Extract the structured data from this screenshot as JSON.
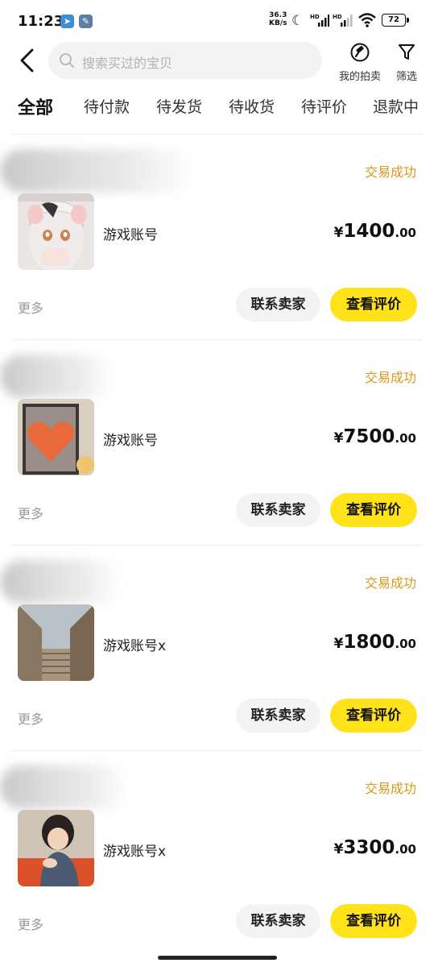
{
  "status_bar": {
    "time": "11:23",
    "net_speed_value": "36.3",
    "net_speed_unit": "KB/s",
    "battery": "72",
    "icons": [
      "telegram-icon",
      "tools-icon",
      "moon-icon",
      "signal-icon",
      "signal-icon",
      "wifi-icon",
      "battery-icon"
    ]
  },
  "header": {
    "search_placeholder": "搜索买过的宝贝",
    "auction_label": "我的拍卖",
    "filter_label": "筛选"
  },
  "tabs": [
    {
      "label": "全部",
      "active": true
    },
    {
      "label": "待付款"
    },
    {
      "label": "待发货"
    },
    {
      "label": "待收货"
    },
    {
      "label": "待评价"
    },
    {
      "label": "退款中"
    }
  ],
  "orders": [
    {
      "status": "交易成功",
      "title": "游戏账号",
      "currency": "¥",
      "price_int": "1400",
      "price_dec": ".00",
      "more": "更多",
      "contact": "联系卖家",
      "review": "查看评价"
    },
    {
      "status": "交易成功",
      "title": "游戏账号",
      "currency": "¥",
      "price_int": "7500",
      "price_dec": ".00",
      "more": "更多",
      "contact": "联系卖家",
      "review": "查看评价"
    },
    {
      "status": "交易成功",
      "title": "游戏账号x",
      "currency": "¥",
      "price_int": "1800",
      "price_dec": ".00",
      "more": "更多",
      "contact": "联系卖家",
      "review": "查看评价"
    },
    {
      "status": "交易成功",
      "title": "游戏账号x",
      "currency": "¥",
      "price_int": "3300",
      "price_dec": ".00",
      "more": "更多",
      "contact": "联系卖家",
      "review": "查看评价"
    }
  ],
  "colors": {
    "accent": "#ffe21a",
    "status": "#d59a1a"
  }
}
